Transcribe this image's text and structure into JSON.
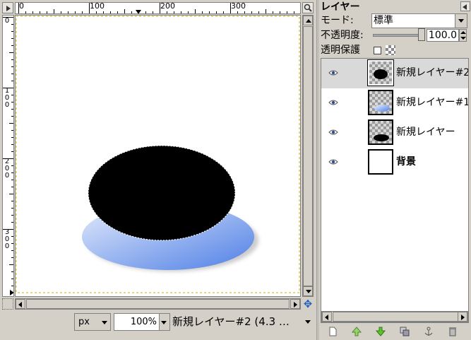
{
  "rulers": {
    "horizontal_labels": [
      "0",
      "100",
      "200",
      "300"
    ],
    "vertical_labels": [
      [
        "0"
      ],
      [
        "1",
        "0",
        "0"
      ],
      [
        "2",
        "0",
        "0"
      ],
      [
        "3",
        "0",
        "0"
      ]
    ]
  },
  "canvas": {
    "background": "#ffffff",
    "guide_color": "#c8b400",
    "shadow_gradient_start": "#e4ecfb",
    "shadow_gradient_end": "#4f7fe6",
    "selected_layer_fill": "#000000"
  },
  "statusbar": {
    "unit": "px",
    "zoom": "100%",
    "status_text": "新規レイヤー#2 (4.3 …"
  },
  "layers_panel": {
    "title": "レイヤー",
    "mode_label": "モード:",
    "mode_value": "標準",
    "opacity_label": "不透明度:",
    "opacity_value": "100.0",
    "opacity_fraction": 1.0,
    "lock_label": "透明保護",
    "lock_checked": false,
    "layers": [
      {
        "name": "新規レイヤー#2",
        "visible": true,
        "selected": true,
        "bold": false,
        "thumb": "black-ellipse-small"
      },
      {
        "name": "新規レイヤー#1",
        "visible": true,
        "selected": false,
        "bold": false,
        "thumb": "blue-ellipse"
      },
      {
        "name": "新規レイヤー",
        "visible": true,
        "selected": false,
        "bold": false,
        "thumb": "black-ellipse"
      },
      {
        "name": "背景",
        "visible": true,
        "selected": false,
        "bold": true,
        "thumb": "white"
      }
    ],
    "toolbar_icons": [
      "new-layer-icon",
      "raise-layer-icon",
      "lower-layer-icon",
      "duplicate-layer-icon",
      "anchor-layer-icon",
      "delete-layer-icon"
    ]
  }
}
